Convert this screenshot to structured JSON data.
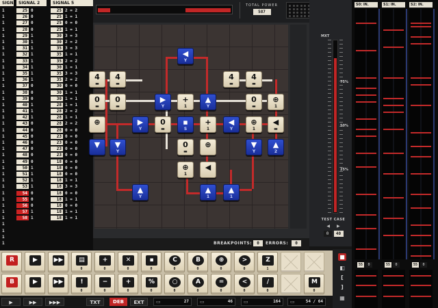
{
  "header": {
    "total_power_label": "TOTAL POWER",
    "total_power_value": "587"
  },
  "signals": {
    "columns": [
      {
        "title": "SIGNAL 1",
        "rows": [
          {
            "in": "",
            "out": "1"
          },
          {
            "in": "",
            "out": "1"
          },
          {
            "in": "",
            "out": "1"
          },
          {
            "in": "",
            "out": "1"
          },
          {
            "in": "",
            "out": "1"
          },
          {
            "in": "",
            "out": "1"
          },
          {
            "in": "",
            "out": "1"
          },
          {
            "in": "",
            "out": "1"
          },
          {
            "in": "",
            "out": "1"
          },
          {
            "in": "",
            "out": "1"
          },
          {
            "in": "",
            "out": "1"
          },
          {
            "in": "",
            "out": "1"
          },
          {
            "in": "",
            "out": "1"
          },
          {
            "in": "",
            "out": "1"
          },
          {
            "in": "",
            "out": "1"
          },
          {
            "in": "",
            "out": "1"
          },
          {
            "in": "",
            "out": "1"
          },
          {
            "in": "",
            "out": "1"
          },
          {
            "in": "",
            "out": "1"
          },
          {
            "in": "",
            "out": "1"
          },
          {
            "in": "",
            "out": "1"
          },
          {
            "in": "",
            "out": "1"
          },
          {
            "in": "",
            "out": "1"
          },
          {
            "in": "",
            "out": "1"
          },
          {
            "in": "",
            "out": "1"
          },
          {
            "in": "",
            "out": "1"
          },
          {
            "in": "",
            "out": "1"
          },
          {
            "in": "",
            "out": "1"
          },
          {
            "in": "",
            "out": "1"
          },
          {
            "in": "",
            "out": "1"
          },
          {
            "in": "",
            "out": "1"
          },
          {
            "in": "",
            "out": "1"
          },
          {
            "in": "",
            "out": "1"
          },
          {
            "in": "",
            "out": "1"
          },
          {
            "in": "",
            "out": "1"
          },
          {
            "in": "",
            "out": "1"
          },
          {
            "in": "",
            "out": "1"
          },
          {
            "in": "",
            "out": "1"
          }
        ]
      },
      {
        "title": "SIGNAL 2",
        "rows": [
          {
            "in": "25",
            "out": "0"
          },
          {
            "in": "26",
            "out": "0"
          },
          {
            "in": "27",
            "out": "0"
          },
          {
            "in": "28",
            "out": "0"
          },
          {
            "in": "29",
            "out": "1"
          },
          {
            "in": "30",
            "out": "1"
          },
          {
            "in": "31",
            "out": "1"
          },
          {
            "in": "32",
            "out": "1"
          },
          {
            "in": "33",
            "out": "1"
          },
          {
            "in": "34",
            "out": "1"
          },
          {
            "in": "35",
            "out": "1"
          },
          {
            "in": "36",
            "out": "1"
          },
          {
            "in": "37",
            "out": "0"
          },
          {
            "in": "38",
            "out": "0"
          },
          {
            "in": "39",
            "out": "0"
          },
          {
            "in": "40",
            "out": "1"
          },
          {
            "in": "41",
            "out": "1"
          },
          {
            "in": "42",
            "out": "1"
          },
          {
            "in": "43",
            "out": "0"
          },
          {
            "in": "44",
            "out": "0"
          },
          {
            "in": "45",
            "out": "0"
          },
          {
            "in": "46",
            "out": "0"
          },
          {
            "in": "47",
            "out": "0"
          },
          {
            "in": "48",
            "out": "0"
          },
          {
            "in": "49",
            "out": "0"
          },
          {
            "in": "50",
            "out": "1"
          },
          {
            "in": "51",
            "out": "1"
          },
          {
            "in": "52",
            "out": "1"
          },
          {
            "in": "53",
            "out": "1"
          },
          {
            "in": "54",
            "out": "0"
          },
          {
            "in": "55",
            "out": "0"
          },
          {
            "in": "56",
            "out": "0"
          },
          {
            "in": "57",
            "out": "1"
          },
          {
            "in": "58",
            "out": "1"
          }
        ]
      },
      {
        "title": "SIGNAL 5",
        "rows": [
          {
            "in": "25",
            "out": "2  = 2"
          },
          {
            "in": "25",
            "out": "1  = 1"
          },
          {
            "in": "25",
            "out": "0  = 0"
          },
          {
            "in": "25",
            "out": "1  = 1"
          },
          {
            "in": "30",
            "out": "3  = 3"
          },
          {
            "in": "30",
            "out": "2  = 2"
          },
          {
            "in": "35",
            "out": "3  = 3"
          },
          {
            "in": "35",
            "out": "1  = 1"
          },
          {
            "in": "35",
            "out": "2  = 2"
          },
          {
            "in": "30",
            "out": "1  = 1"
          },
          {
            "in": "35",
            "out": "3  = 3"
          },
          {
            "in": "35",
            "out": "2  = 2"
          },
          {
            "in": "30",
            "out": "0  = 0"
          },
          {
            "in": "30",
            "out": "1  = 1"
          },
          {
            "in": "30",
            "out": "1  = 1"
          },
          {
            "in": "28",
            "out": "1  = 1"
          },
          {
            "in": "28",
            "out": "2  = 2"
          },
          {
            "in": "28",
            "out": "1  = 1"
          },
          {
            "in": "28",
            "out": "2  = 2"
          },
          {
            "in": "28",
            "out": "0  = 0"
          },
          {
            "in": "23",
            "out": "0  = 0"
          },
          {
            "in": "23",
            "out": "0  = 0"
          },
          {
            "in": "23",
            "out": "0  = 0"
          },
          {
            "in": "23",
            "out": "0  = 0"
          },
          {
            "in": "18",
            "out": "0  = 0"
          },
          {
            "in": "18",
            "out": "0  = 0"
          },
          {
            "in": "18",
            "out": "0  = 0"
          },
          {
            "in": "18",
            "out": "1  = 1"
          },
          {
            "in": "18",
            "out": "3  = 3"
          },
          {
            "in": "18",
            "out": "0  = 0"
          },
          {
            "in": "18",
            "out": "1  = 1"
          },
          {
            "in": "18",
            "out": "0  = 0"
          },
          {
            "in": "18",
            "out": "1  = 1"
          },
          {
            "in": "18",
            "out": "1  = 1"
          }
        ]
      }
    ]
  },
  "board": {
    "tiles": [
      {
        "c": "blue",
        "g": "◀",
        "s": "Y"
      },
      {
        "c": "cream",
        "g": "4",
        "s": "▬"
      },
      {
        "c": "cream",
        "g": "4",
        "s": "▬"
      },
      {
        "c": "cream",
        "g": "4",
        "s": "▬"
      },
      {
        "c": "cream",
        "g": "0",
        "s": "▬"
      },
      {
        "c": "blue",
        "g": "▶",
        "s": "Y"
      },
      {
        "c": "cream",
        "g": "+",
        "s": "1"
      },
      {
        "c": "blue",
        "g": "▲",
        "s": "Y"
      },
      {
        "c": "cream",
        "g": "0",
        "s": "▬"
      },
      {
        "c": "cream",
        "g": "⊕",
        "s": "1"
      },
      {
        "c": "cream",
        "g": "⊕",
        "s": ""
      },
      {
        "c": "blue",
        "g": "▶",
        "s": "Y"
      },
      {
        "c": "cream",
        "g": "0",
        "s": "▬"
      },
      {
        "c": "blue",
        "g": "▪",
        "s": "S"
      },
      {
        "c": "cream",
        "g": "+",
        "s": "1"
      },
      {
        "c": "blue",
        "g": "◀",
        "s": "Y"
      },
      {
        "c": "cream",
        "g": "⊕",
        "s": "1"
      },
      {
        "c": "cream",
        "g": "◀",
        "s": "▬"
      },
      {
        "c": "blue",
        "g": "▼",
        "s": ""
      },
      {
        "c": "blue",
        "g": "▼",
        "s": "Y"
      },
      {
        "c": "cream",
        "g": "0",
        "s": "▬"
      },
      {
        "c": "cream",
        "g": "⊕",
        "s": ""
      },
      {
        "c": "blue",
        "g": "▼",
        "s": "Y"
      },
      {
        "c": "blue",
        "g": "▲",
        "s": "2"
      },
      {
        "c": "cream",
        "g": "⊕",
        "s": "1"
      },
      {
        "c": "cream",
        "g": "◀",
        "s": ""
      },
      {
        "c": "blue",
        "g": "▲",
        "s": "Y"
      },
      {
        "c": "blue",
        "g": "▲",
        "s": "1"
      },
      {
        "c": "blue",
        "g": "▲",
        "s": "1"
      },
      {
        "c": "cream",
        "g": "4",
        "s": "▬"
      },
      {
        "c": "cream",
        "g": "0",
        "s": "▬"
      }
    ]
  },
  "status": {
    "breakpoints_label": "BREAKPOINTS:",
    "breakpoints_value": "0",
    "errors_label": "ERRORS:",
    "errors_value": "0"
  },
  "meter": {
    "max_label": "MXT",
    "pct_75": "75%",
    "pct_50": "50%",
    "pct_25": "25%",
    "level": 0.9,
    "test_case_label": "TEST CASE",
    "test_case_values": [
      "0",
      "40"
    ]
  },
  "scopes": [
    {
      "label": "S0: IN.",
      "foot": [
        "55",
        "0"
      ]
    },
    {
      "label": "S1: IN.",
      "foot": [
        "55",
        "0"
      ]
    },
    {
      "label": "S2: IN.",
      "foot": [
        "55",
        "0"
      ]
    }
  ],
  "palette": {
    "row1": [
      {
        "g": "R",
        "n": "",
        "style": "red"
      },
      {
        "g": "▶",
        "n": ""
      },
      {
        "g": "▶▶",
        "n": ""
      },
      {
        "g": "▤",
        "n": "0"
      },
      {
        "g": "+",
        "n": "0"
      },
      {
        "g": "✕",
        "n": "0"
      },
      {
        "g": "▪",
        "n": "0"
      },
      {
        "g": "C",
        "n": "0",
        "round": true
      },
      {
        "g": "B",
        "n": "0",
        "round": true
      },
      {
        "g": "⊕",
        "n": "0",
        "round": true
      },
      {
        "g": ">",
        "n": "0",
        "round": true
      },
      {
        "g": "Z",
        "n": "1"
      },
      {
        "g": "",
        "n": "",
        "ghost": true
      },
      {
        "g": "",
        "n": "",
        "ghost": true
      }
    ],
    "row2": [
      {
        "g": "B",
        "n": "",
        "style": "red"
      },
      {
        "g": "▶",
        "n": ""
      },
      {
        "g": "▶▶",
        "n": ""
      },
      {
        "g": "!",
        "n": "0"
      },
      {
        "g": "−",
        "n": "0"
      },
      {
        "g": "+",
        "n": "0"
      },
      {
        "g": "%",
        "n": "0"
      },
      {
        "g": "○",
        "n": "0",
        "round": true
      },
      {
        "g": "A",
        "n": "0",
        "round": true
      },
      {
        "g": "=",
        "n": "0",
        "round": true
      },
      {
        "g": "<",
        "n": "0",
        "round": true
      },
      {
        "g": "/",
        "n": "0"
      },
      {
        "g": "",
        "n": "",
        "ghost": true
      },
      {
        "g": "M",
        "n": "0"
      }
    ]
  },
  "bottombar": {
    "play_glyph": "▶",
    "ff_glyph": "▶▶",
    "fff_glyph": "▶▶▶",
    "txt": "TXT",
    "deb": "DEB",
    "ext": "EXT",
    "field1": "27",
    "field2": "46",
    "field3": "164",
    "field4": "54 / 64"
  }
}
